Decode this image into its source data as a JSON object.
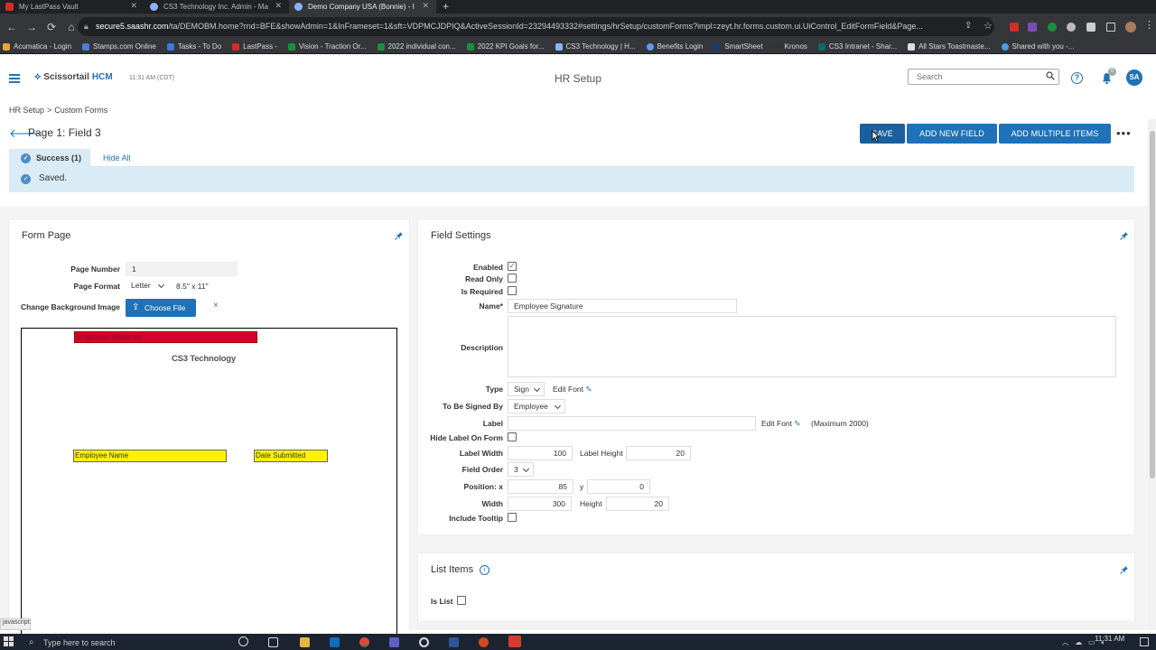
{
  "browser": {
    "tabs": [
      {
        "title": "My LastPass Vault",
        "color": "#d32d27",
        "active": false
      },
      {
        "title": "CS3 Technology Inc. Admin - Ma",
        "color": "#8ab4f8",
        "active": false
      },
      {
        "title": "Demo Company USA (Bonnie) - I",
        "color": "#8ab4f8",
        "active": true
      }
    ],
    "url_host": "secure5.saashr.com",
    "url_path": "/ta/DEMOBM.home?rnd=BFE&showAdmin=1&InFrameset=1&sft=VDPMCJDPIQ&ActiveSessionId=23294493332#settings/hrSetup/customForms?impl=zeyt.hr.forms.custom.ui.UiControl_EditFormField&Page...",
    "bookmarks": [
      {
        "label": "Acumatica - Login",
        "color": "#e8a33d"
      },
      {
        "label": "Stamps.com Online",
        "color": "#4a7fd1"
      },
      {
        "label": "Tasks - To Do",
        "color": "#3a7bd5"
      },
      {
        "label": "LastPass -",
        "color": "#d32d27"
      },
      {
        "label": "Vision - Traction Or...",
        "color": "#1e8e3e"
      },
      {
        "label": "2022 individual con...",
        "color": "#1e8e3e"
      },
      {
        "label": "2022 KPI Goals for...",
        "color": "#1e8e3e"
      },
      {
        "label": "CS3 Technology | H...",
        "color": "#8ab4f8"
      },
      {
        "label": "Benefits Login",
        "color": "#5f9cf2"
      },
      {
        "label": "SmartSheet",
        "color": "#1a3c6e"
      },
      {
        "label": "Kronos",
        "color": "#333"
      },
      {
        "label": "CS3 Intranet - Shar...",
        "color": "#0b6a6a"
      },
      {
        "label": "All Stars Toastmaste...",
        "color": "#ddd"
      },
      {
        "label": "Shared with you -...",
        "color": "#4a9fe8"
      }
    ]
  },
  "app": {
    "brand": "Scissortail",
    "brand_suffix": "HCM",
    "clock": "11:31 AM (CDT)",
    "page_title": "HR Setup",
    "search_placeholder": "Search",
    "notifications_count": "0",
    "avatar_initials": "SA"
  },
  "breadcrumb": {
    "root": "HR Setup",
    "sep": ">",
    "current": "Custom Forms"
  },
  "form_title": "Page 1: Field 3",
  "actions": {
    "save": "SAVE",
    "add_field": "ADD NEW FIELD",
    "add_multiple": "ADD MULTIPLE ITEMS",
    "more": "•••"
  },
  "messages": {
    "success_tab": "Success (1)",
    "hide_all": "Hide All",
    "saved": "Saved."
  },
  "form_page": {
    "title": "Form Page",
    "page_number_label": "Page Number",
    "page_number": "1",
    "page_format_label": "Page Format",
    "page_format": "Letter",
    "page_size": "8.5\" x 11\"",
    "bg_label": "Change Background Image",
    "choose_file": "Choose File",
    "clear": "×",
    "canvas": {
      "logo_text": "CS3 Technology",
      "fields": [
        {
          "label": "Employee Signature",
          "kind": "red"
        },
        {
          "label": "Employee Name",
          "kind": "yellow"
        },
        {
          "label": "Date Submitted",
          "kind": "yellow"
        }
      ]
    }
  },
  "field_settings": {
    "title": "Field Settings",
    "enabled_label": "Enabled",
    "enabled": true,
    "read_only_label": "Read Only",
    "read_only": false,
    "required_label": "Is Required",
    "required": false,
    "name_label": "Name*",
    "name": "Employee Signature",
    "description_label": "Description",
    "description": "",
    "type_label": "Type",
    "type": "Sign",
    "edit_font": "Edit Font",
    "signed_by_label": "To Be Signed By",
    "signed_by": "Employee",
    "label_label": "Label",
    "label": "",
    "max_note": "(Maximum 2000)",
    "hide_label_label": "Hide Label On Form",
    "label_width_label": "Label Width",
    "label_width": "100",
    "label_height_label": "Label Height",
    "label_height": "20",
    "field_order_label": "Field Order",
    "field_order": "3",
    "pos_x_label": "Position: x",
    "pos_x": "85",
    "pos_y_label": "y",
    "pos_y": "0",
    "width_label": "Width",
    "width": "300",
    "height_label": "Height",
    "height": "20",
    "tooltip_label": "Include Tooltip"
  },
  "list_items": {
    "title": "List Items",
    "is_list_label": "Is List"
  },
  "taskbar": {
    "search_placeholder": "Type here to search",
    "time": "11:31 AM"
  },
  "status": {
    "js": "javascript:"
  }
}
